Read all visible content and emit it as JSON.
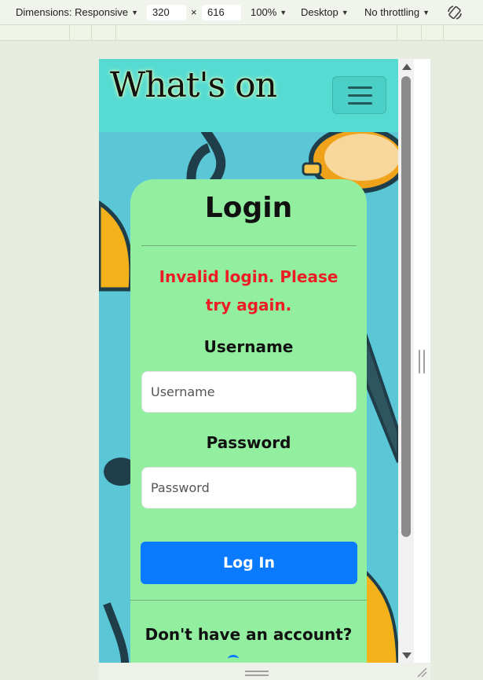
{
  "devtools": {
    "dimensions_label": "Dimensions: Responsive",
    "width": "320",
    "times": "×",
    "height": "616",
    "zoom": "100%",
    "device": "Desktop",
    "throttling": "No throttling",
    "icons": [
      "caret-down-icon",
      "rotate-icon"
    ]
  },
  "site": {
    "brand": "What's on",
    "colors": {
      "navbar": "#56dbd3",
      "card": "#92ef9f",
      "error": "#ee1c24",
      "button": "#0a7aff"
    }
  },
  "login": {
    "title": "Login",
    "error": "Invalid login. Please try again.",
    "username_label": "Username",
    "username_placeholder": "Username",
    "password_label": "Password",
    "password_placeholder": "Password",
    "submit_label": "Log In",
    "no_account_text": "Don't have an account?"
  }
}
